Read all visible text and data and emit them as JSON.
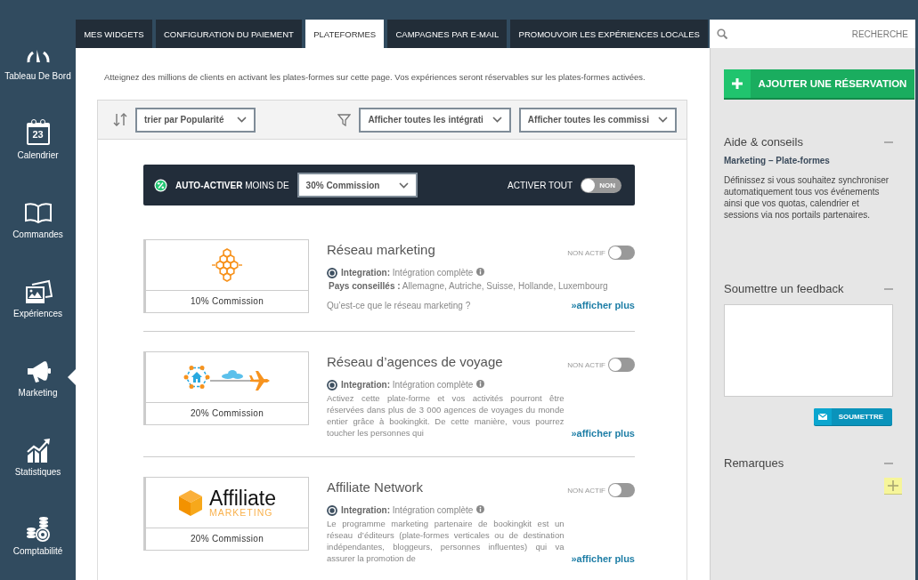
{
  "sidebar": {
    "items": [
      {
        "label": "Tableau De Bord",
        "selected": false
      },
      {
        "label": "Calendrier",
        "icon_text": "23",
        "selected": false
      },
      {
        "label": "Commandes",
        "selected": false
      },
      {
        "label": "Expériences",
        "selected": false
      },
      {
        "label": "Marketing",
        "selected": true
      },
      {
        "label": "Statistiques",
        "selected": false
      },
      {
        "label": "Comptabilité",
        "selected": false
      }
    ]
  },
  "tabs": [
    {
      "label": "MES WIDGETS",
      "selected": false
    },
    {
      "label": "CONFIGURATION DU PAIEMENT",
      "selected": false
    },
    {
      "label": "PLATEFORMES",
      "selected": true
    },
    {
      "label": "CAMPAGNES PAR E-MAIL",
      "selected": false
    },
    {
      "label": "PROMOUVOIR LES EXPÉRIENCES LOCALES",
      "selected": false
    }
  ],
  "search": {
    "placeholder": "RECHERCHE"
  },
  "intro": "Atteignez des millions de clients en activant les plates-formes sur cette page. Vos expériences seront réservables sur les plates-formes activées.",
  "filters": {
    "sort": "trier par Popularité",
    "integration": "Afficher toutes les intégrati",
    "commission": "Afficher toutes les commissi"
  },
  "auto_activate": {
    "label": "**AUTO-ACTIVER** MOINS DE",
    "threshold": "30% Commission",
    "all_label": "ACTIVER TOUT",
    "toggle": {
      "text": "NON",
      "on": false
    }
  },
  "platforms": [
    {
      "name": "Réseau marketing",
      "commission": "10% Commission",
      "status": "NON ACTIF",
      "on": false,
      "integration": "**Integration:** Intégration complète",
      "countries": "**Pays conseillés :** Allemagne, Autriche, Suisse, Hollande, Luxembourg",
      "question": "Qu’est-ce que le réseau marketing ?",
      "more": "»afficher plus"
    },
    {
      "name": "Réseau d’agences de voyage",
      "commission": "20% Commission",
      "status": "NON ACTIF",
      "on": false,
      "integration": "**Integration:** Intégration complète",
      "description": "Activez cette plate-forme et vos activités pourront être réservées dans plus de 3 000 agences de voyages du monde entier grâce à bookingkit. De cette manière, vous pourrez toucher les personnes qui",
      "more": "»afficher plus"
    },
    {
      "name": "Affiliate Network",
      "commission": "20% Commission",
      "status": "NON ACTIF",
      "on": false,
      "logo_text": "Affiliate",
      "logo_subtext": "MARKETING",
      "integration": "**Integration:** Intégration complète",
      "description": "Le programme marketing partenaire de bookingkit est un réseau d’éditeurs (plate-formes verticales ou de destination indépendantes, bloggeurs, personnes influentes) qui va assurer la promotion de",
      "more": "»afficher plus"
    }
  ],
  "aside": {
    "add_button": "AJOUTER UNE RÉSERVATION",
    "help": {
      "title": "Aide & conseils",
      "subtitle": "Marketing – Plate-formes",
      "text": "Définissez si vous souhaitez synchroniser automatiquement tous vos événements ainsi que vos quotas, calendrier et sessions via nos portails partenaires."
    },
    "feedback": {
      "title": "Soumettre un feedback",
      "button": "SOUMETTRE"
    },
    "notes": {
      "title": "Remarques"
    }
  }
}
